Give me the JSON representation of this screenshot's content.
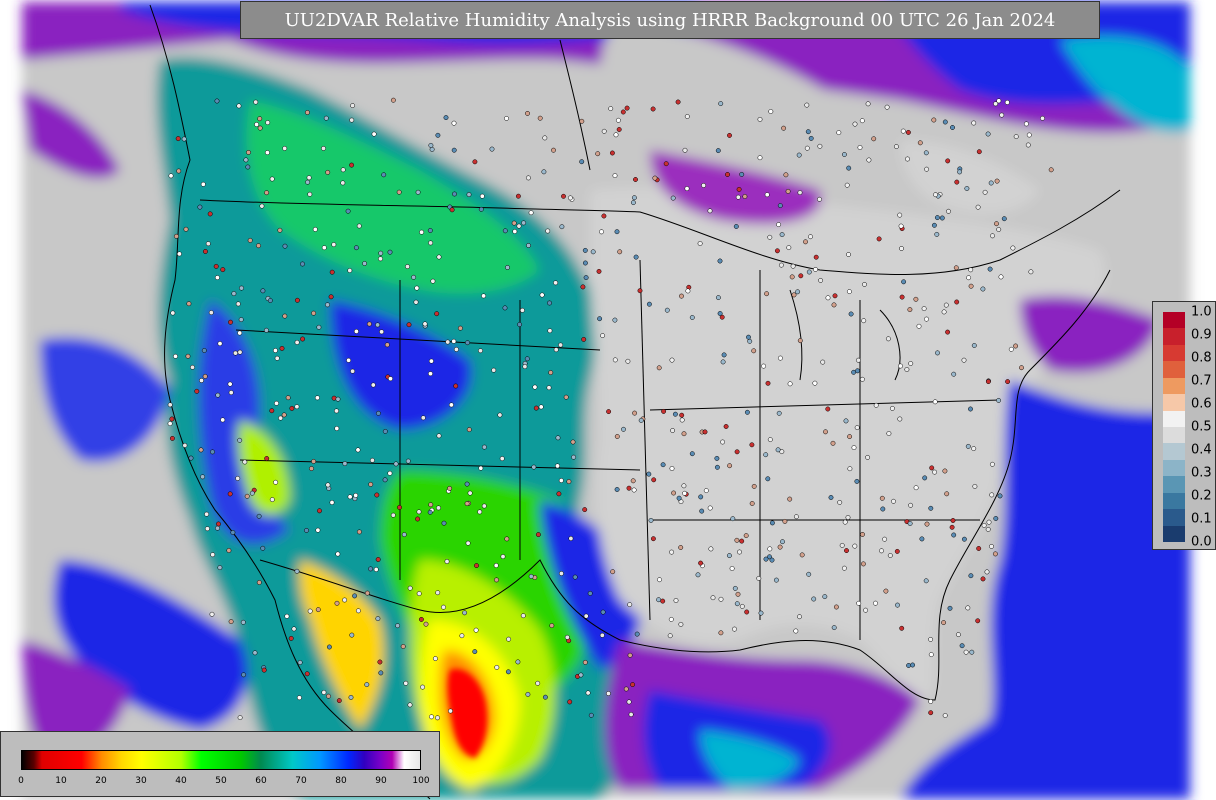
{
  "title": "UU2DVAR Relative Humidity Analysis using HRRR Background 00 UTC 26 Jan 2024",
  "horizontal_colorbar": {
    "ticks": [
      "0",
      "10",
      "20",
      "30",
      "40",
      "50",
      "60",
      "70",
      "80",
      "90",
      "100"
    ]
  },
  "vertical_colorbar": {
    "ticks": [
      "1.0",
      "0.9",
      "0.8",
      "0.7",
      "0.6",
      "0.5",
      "0.4",
      "0.3",
      "0.2",
      "0.1",
      "0.0"
    ],
    "colors": [
      "#b40026",
      "#c8202c",
      "#d73a32",
      "#e0603c",
      "#ee9a60",
      "#f6c8a8",
      "#f2f2f2",
      "#dcdcdc",
      "#b4c8d2",
      "#8cb4c8",
      "#5a96b4",
      "#3a78a0",
      "#2a5a8c",
      "#1a3c6e"
    ]
  },
  "map_colors": {
    "ocean_gray": "#c8c8c8",
    "land_gray": "#d4d4d4",
    "purple": "#7a18b4",
    "violet": "#9b2dbe",
    "blue": "#1e28e6",
    "cyan": "#00b4d2",
    "teal": "#0a9a9a",
    "green": "#12d000",
    "lime": "#a0f000",
    "yellow": "#ffff00",
    "orange": "#ffa500",
    "red": "#ff0000"
  }
}
